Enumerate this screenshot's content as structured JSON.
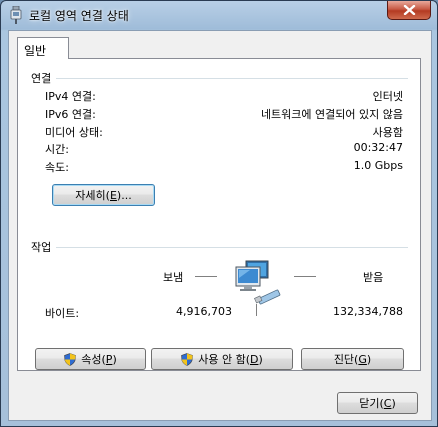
{
  "window": {
    "title": "로컬 영역 연결 상태"
  },
  "tabs": [
    {
      "label": "일반"
    }
  ],
  "connection": {
    "group_label": "연결",
    "rows": [
      {
        "label": "IPv4 연결:",
        "value": "인터넷"
      },
      {
        "label": "IPv6 연결:",
        "value": "네트워크에 연결되어 있지 않음"
      },
      {
        "label": "미디어 상태:",
        "value": "사용함"
      },
      {
        "label": "시간:",
        "value": "00:32:47"
      },
      {
        "label": "속도:",
        "value": "1.0 Gbps"
      }
    ],
    "details_button": {
      "text": "자세히(",
      "key": "E",
      "suffix": ")..."
    }
  },
  "activity": {
    "group_label": "작업",
    "sent_label": "보냄",
    "received_label": "받음",
    "bytes_label": "바이트:",
    "bytes_sent": "4,916,703",
    "bytes_received": "132,334,788"
  },
  "buttons": {
    "properties": {
      "text": "속성(",
      "key": "P",
      "suffix": ")"
    },
    "disable": {
      "text": "사용 안 함(",
      "key": "D",
      "suffix": ")"
    },
    "diagnose": {
      "text": "진단(",
      "key": "G",
      "suffix": ")"
    },
    "close": {
      "text": "닫기(",
      "key": "C",
      "suffix": ")"
    }
  },
  "icons": {
    "title": "network-adapter-icon",
    "activity": "network-computers-icon",
    "admin": "uac-shield-icon"
  },
  "colors": {
    "title_bar": "#a6c0da",
    "close_button": "#c75a45",
    "group_line": "#d5dfe5",
    "focus_border": "#3c7fb1"
  }
}
